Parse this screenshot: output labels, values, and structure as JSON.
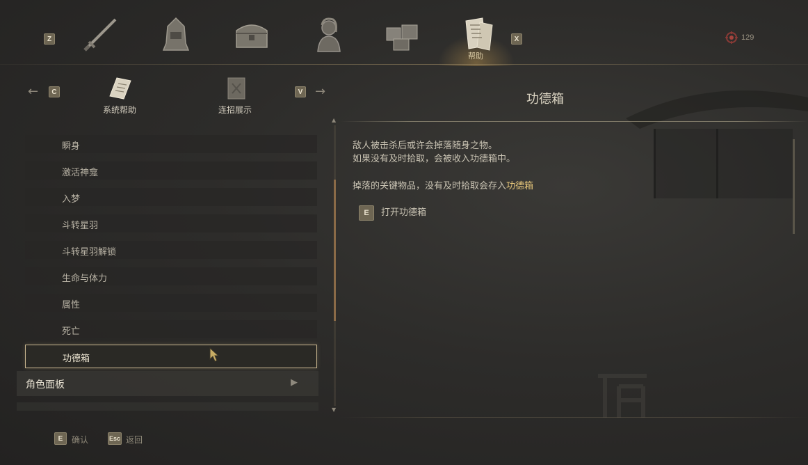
{
  "top_tabs": [
    {
      "key": "Z"
    },
    {
      "icon": "sword-icon"
    },
    {
      "icon": "helmet-icon"
    },
    {
      "icon": "chest-icon"
    },
    {
      "icon": "character-portrait-icon"
    },
    {
      "icon": "crates-icon"
    },
    {
      "icon": "book-scroll-icon",
      "label": "帮助",
      "active": true
    },
    {
      "key": "X"
    }
  ],
  "tab_keys": {
    "left": "Z",
    "right": "X"
  },
  "active_tab_label": "帮助",
  "currency": {
    "icon": "spirit-currency-icon",
    "value": "129"
  },
  "subtabs": {
    "prev_key": "C",
    "next_key": "V",
    "items": [
      {
        "label": "系统帮助",
        "icon": "manual-book-icon"
      },
      {
        "label": "连招展示",
        "icon": "scroll-icon"
      }
    ]
  },
  "help_list": {
    "items": [
      "瞬身",
      "激活神龛",
      "入梦",
      "斗转星羽",
      "斗转星羽解锁",
      "生命与体力",
      "属性",
      "死亡",
      "功德箱"
    ],
    "selected": "功德箱",
    "category": "角色面板"
  },
  "detail": {
    "title": "功德箱",
    "line1": "敌人被击杀后或许会掉落随身之物。",
    "line2": "如果没有及时拾取，会被收入功德箱中。",
    "line3_prefix": "掉落的关键物品，没有及时拾取会存入",
    "line3_highlight": "功德箱",
    "action_key": "E",
    "action_label": "打开功德箱"
  },
  "footer": {
    "confirm_key": "E",
    "confirm_label": "确认",
    "back_key": "Esc",
    "back_label": "返回"
  },
  "colors": {
    "highlight": "#e7c77b",
    "selected_border": "#c9b690",
    "scrollbar": "#8a6a47"
  }
}
